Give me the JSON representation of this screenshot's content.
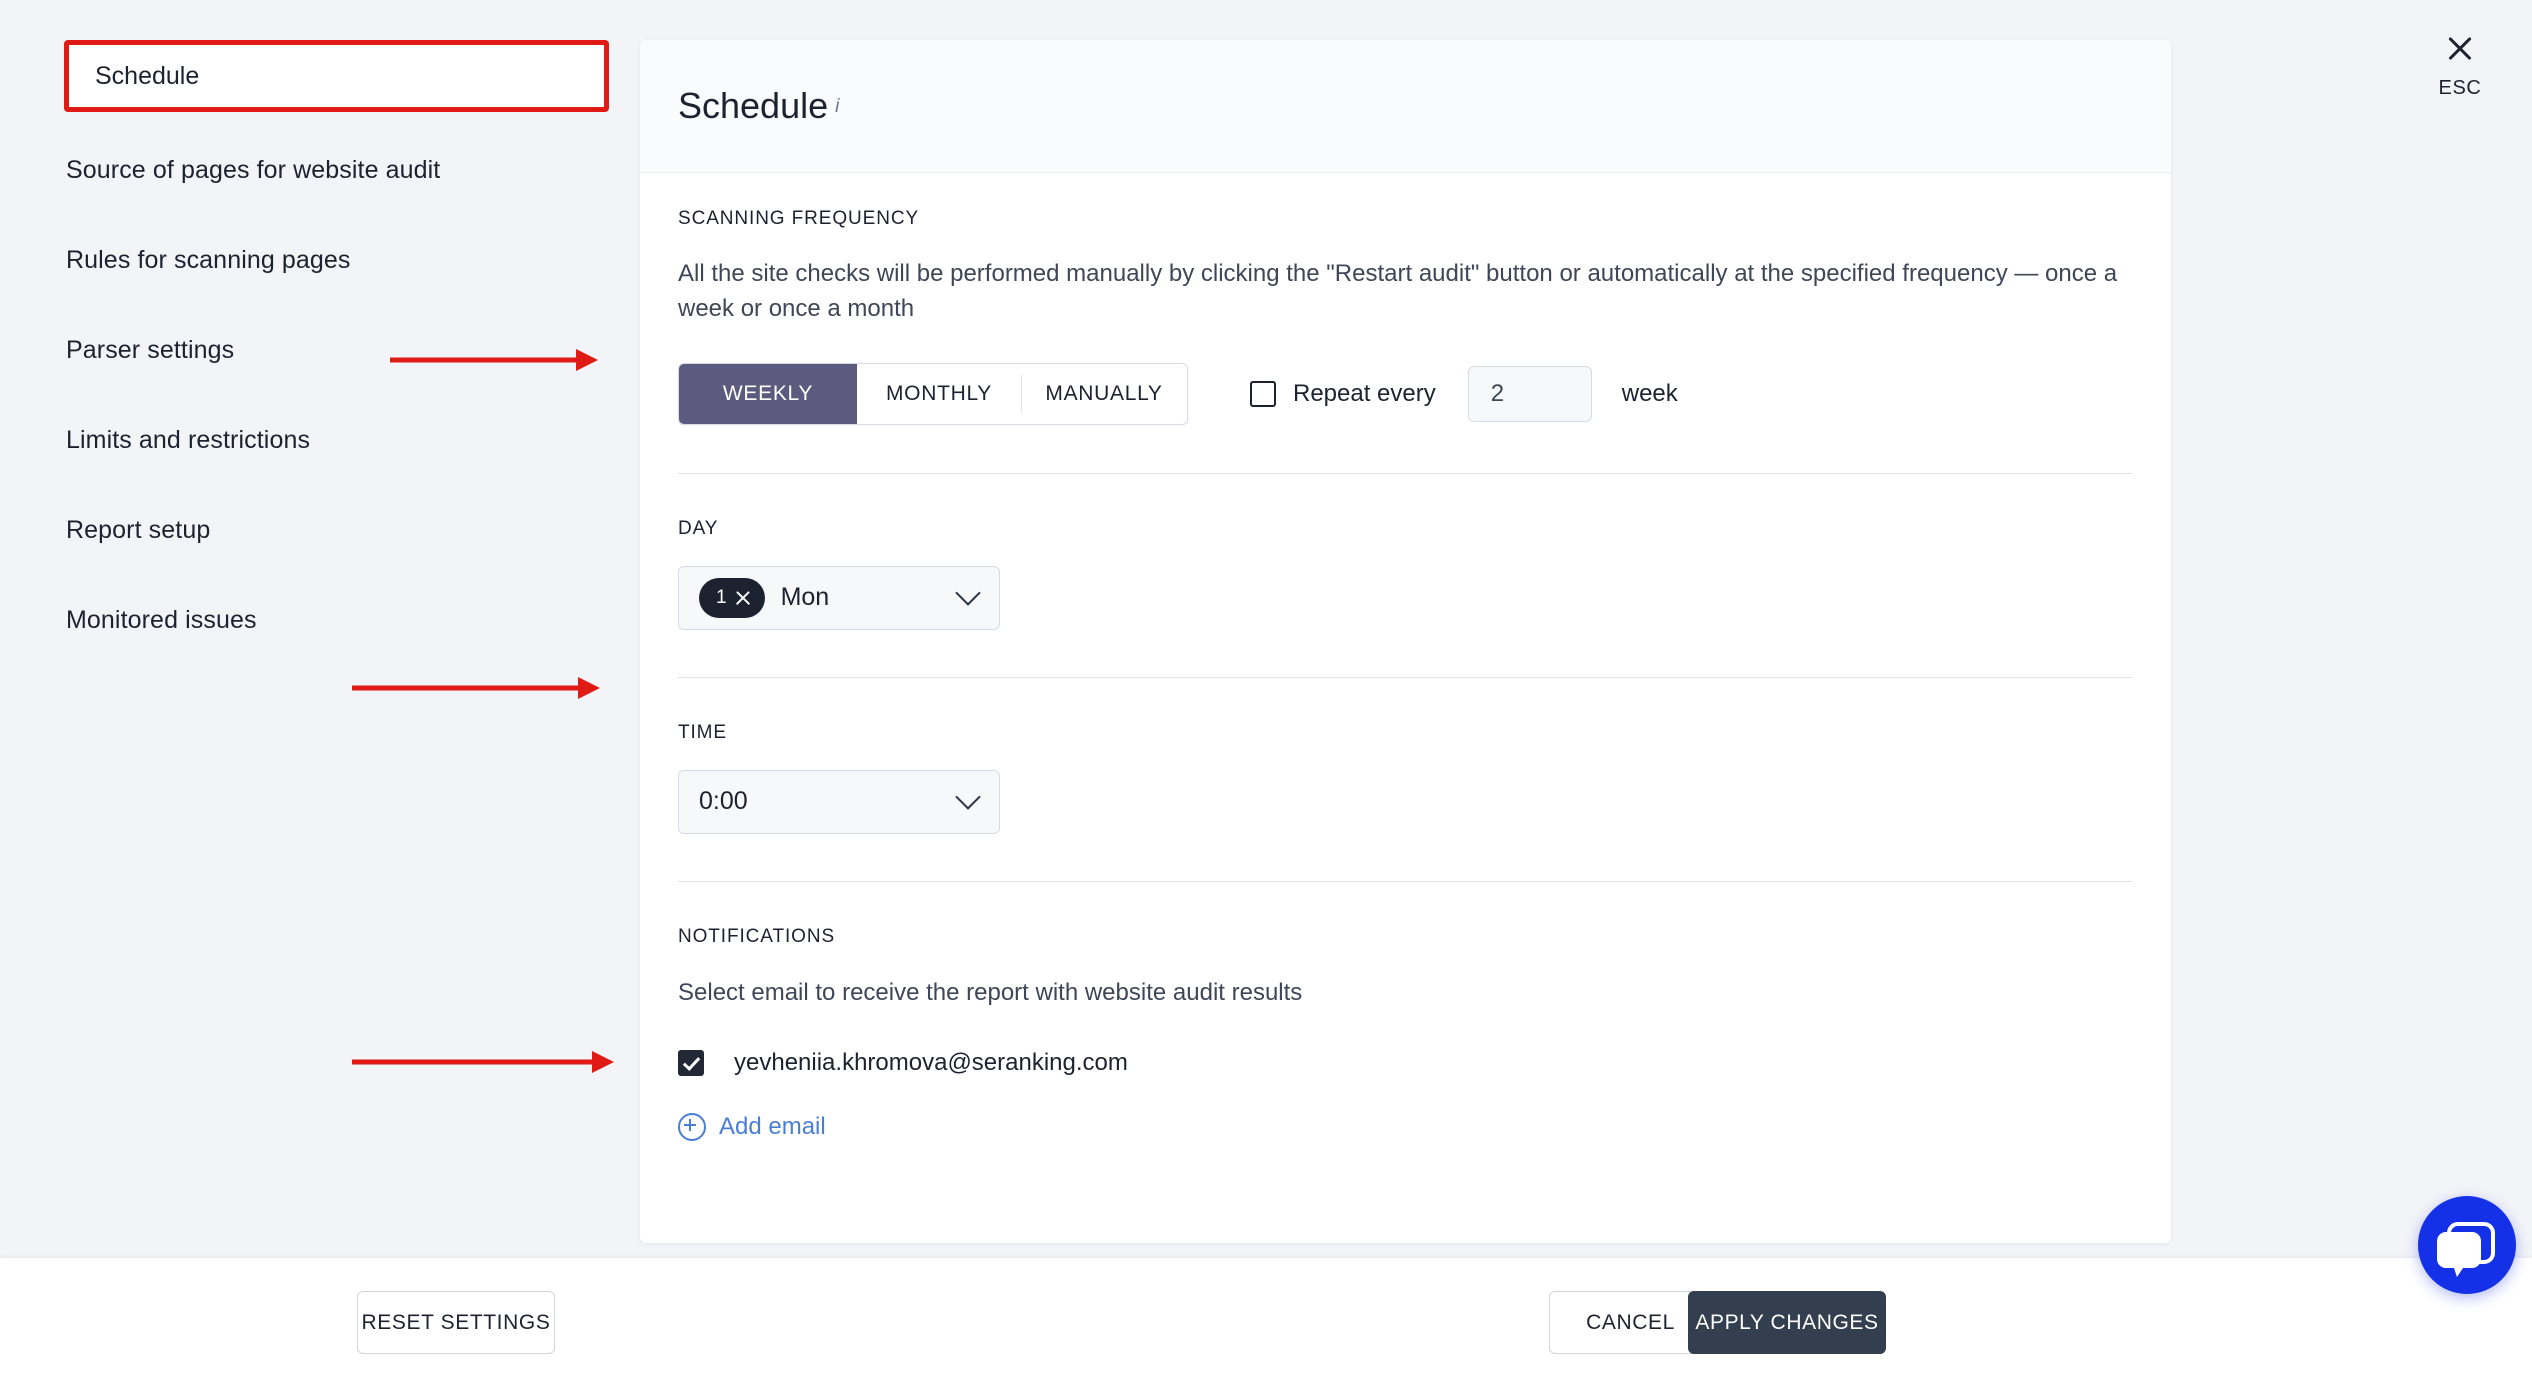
{
  "sidebar": {
    "items": [
      {
        "label": "Schedule",
        "active": true
      },
      {
        "label": "Source of pages for website audit",
        "active": false
      },
      {
        "label": "Rules for scanning pages",
        "active": false
      },
      {
        "label": "Parser settings",
        "active": false
      },
      {
        "label": "Limits and restrictions",
        "active": false
      },
      {
        "label": "Report setup",
        "active": false
      },
      {
        "label": "Monitored issues",
        "active": false
      }
    ]
  },
  "header": {
    "title": "Schedule",
    "info_icon": "i"
  },
  "close": {
    "icon": "close-icon",
    "label": "ESC"
  },
  "scanning_frequency": {
    "label": "SCANNING FREQUENCY",
    "description": "All the site checks will be performed manually by clicking the \"Restart audit\" button or automatically at the specified frequency — once a week or once a month",
    "options": [
      {
        "label": "WEEKLY",
        "selected": true
      },
      {
        "label": "MONTHLY",
        "selected": false
      },
      {
        "label": "MANUALLY",
        "selected": false
      }
    ],
    "repeat": {
      "checked": false,
      "label": "Repeat every",
      "value": "2",
      "unit": "week"
    }
  },
  "day": {
    "label": "DAY",
    "chip_number": "1",
    "chip_remove_icon": "close-icon",
    "value": "Mon",
    "caret_icon": "chevron-down-icon"
  },
  "time": {
    "label": "TIME",
    "value": "0:00",
    "caret_icon": "chevron-down-icon"
  },
  "notifications": {
    "label": "NOTIFICATIONS",
    "description": "Select email to receive the report with website audit results",
    "emails": [
      {
        "address": "yevheniia.khromova@seranking.com",
        "checked": true
      }
    ],
    "add_email_label": "Add email",
    "add_email_icon": "plus-circle-icon"
  },
  "footer": {
    "reset_label": "RESET SETTINGS",
    "cancel_label": "CANCEL",
    "apply_label": "APPLY CHANGES"
  },
  "chat": {
    "icon": "chat-bubble-icon"
  },
  "colors": {
    "accent_active": "#5c5a7e",
    "apply_button": "#333f4f",
    "link": "#4a7ed6",
    "annotation": "#e01b16",
    "chat": "#1531e8"
  }
}
